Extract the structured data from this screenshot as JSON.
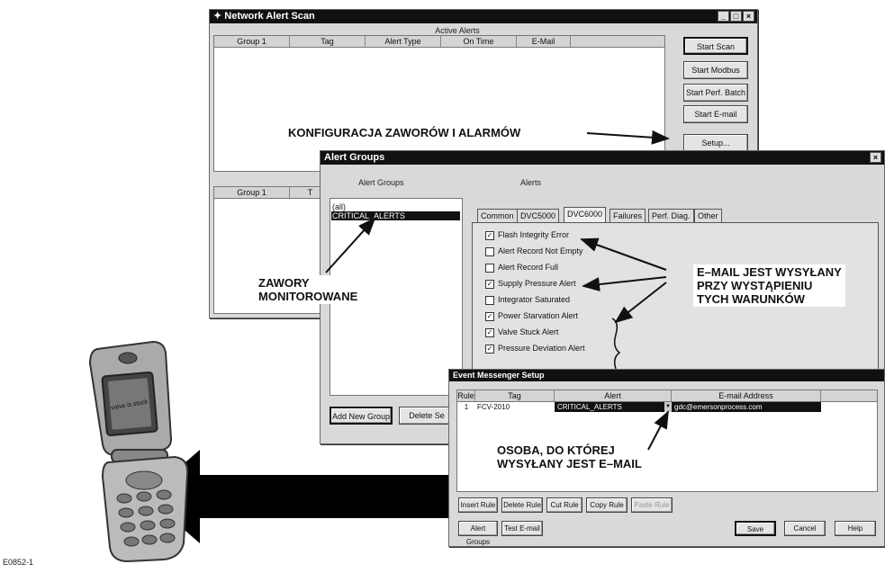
{
  "figure_code": "E0852-1",
  "scan_window": {
    "title": "Network Alert Scan",
    "section_title": "Active Alerts",
    "columns": [
      "Group 1",
      "Tag",
      "Alert Type",
      "On Time",
      "E-Mail"
    ],
    "lower_columns": [
      "Group 1",
      "T"
    ],
    "buttons": {
      "start_scan": "Start Scan",
      "start_modbus": "Start Modbus",
      "start_perf_batch": "Start Perf. Batch",
      "start_email": "Start E-mail",
      "setup": "Setup..."
    }
  },
  "groups_window": {
    "title": "Alert Groups",
    "groups_label": "Alert Groups",
    "alerts_label": "Alerts",
    "groups": [
      "(all)",
      "CRITICAL_ALERTS"
    ],
    "selected_group": "CRITICAL_ALERTS",
    "tabs": [
      "Common",
      "DVC5000",
      "DVC6000",
      "Failures",
      "Perf. Diag.",
      "Other"
    ],
    "active_tab": "DVC6000",
    "alerts": [
      {
        "label": "Flash Integrity Error",
        "checked": true
      },
      {
        "label": "Alert Record Not Empty",
        "checked": false
      },
      {
        "label": "Alert Record Full",
        "checked": false
      },
      {
        "label": "Supply Pressure Alert",
        "checked": true
      },
      {
        "label": "Integrator Saturated",
        "checked": false
      },
      {
        "label": "Power Starvation Alert",
        "checked": true
      },
      {
        "label": "Valve Stuck Alert",
        "checked": true
      },
      {
        "label": "Pressure Deviation Alert",
        "checked": true
      }
    ],
    "buttons": {
      "add_group": "Add New Group",
      "delete": "Delete Se"
    }
  },
  "messenger_window": {
    "title": "Event Messenger Setup",
    "columns": [
      "Rule",
      "Tag",
      "Alert",
      "E-mail Address"
    ],
    "rows": [
      {
        "rule": "1",
        "tag": "FCV-2010",
        "alert": "CRITICAL_ALERTS",
        "email": "gdc@emersonprocess.com"
      }
    ],
    "buttons": {
      "insert_rule": "Insert Rule",
      "delete_rule": "Delete Rule",
      "cut_rule": "Cut Rule",
      "copy_rule": "Copy Rule",
      "paste_rule": "Paste Rule",
      "alert_groups": "Alert Groups",
      "test_email": "Test E-mail",
      "save": "Save",
      "cancel": "Cancel",
      "help": "Help"
    }
  },
  "annotations": {
    "config": "KONFIGURACJA ZAWORÓW I ALARMÓW",
    "valves_1": "ZAWORY",
    "valves_2": "MONITOROWANE",
    "email_1": "E–MAIL JEST WYSYŁANY",
    "email_2": "PRZY WYSTĄPIENIU",
    "email_3": "TYCH WARUNKÓW",
    "person_1": "OSOBA, DO KTÓREJ",
    "person_2": "WYSYŁANY JEST E–MAIL"
  },
  "phone": {
    "screen_text": "valve is stuck"
  }
}
